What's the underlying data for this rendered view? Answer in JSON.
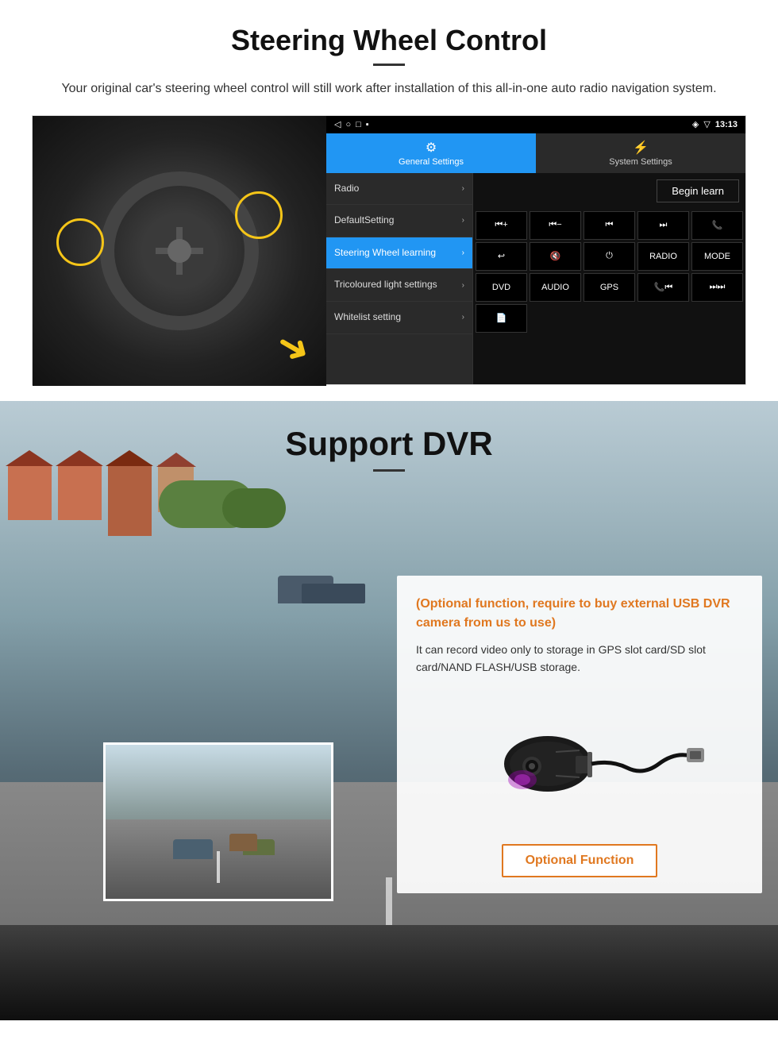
{
  "steering_section": {
    "title": "Steering Wheel Control",
    "description": "Your original car's steering wheel control will still work after installation of this all-in-one auto radio navigation system.",
    "android_ui": {
      "status_bar": {
        "signal": "▼",
        "wifi": "▼",
        "time": "13:13"
      },
      "tabs": [
        {
          "icon": "⚙",
          "label": "General Settings",
          "active": true
        },
        {
          "icon": "⚡",
          "label": "System Settings",
          "active": false
        }
      ],
      "menu_items": [
        {
          "label": "Radio",
          "active": false
        },
        {
          "label": "DefaultSetting",
          "active": false
        },
        {
          "label": "Steering Wheel learning",
          "active": true
        },
        {
          "label": "Tricoloured light settings",
          "active": false
        },
        {
          "label": "Whitelist setting",
          "active": false
        }
      ],
      "begin_learn_button": "Begin learn",
      "control_buttons": [
        "▐+",
        "▐−",
        "⏮",
        "⏭",
        "📞",
        "↩",
        "🔇×",
        "⏻",
        "RADIO",
        "MODE",
        "DVD",
        "AUDIO",
        "GPS",
        "📞⏮",
        "⏭⏭"
      ],
      "extra_button": "📄"
    }
  },
  "dvr_section": {
    "title": "Support DVR",
    "optional_text": "(Optional function, require to buy external USB DVR camera from us to use)",
    "description": "It can record video only to storage in GPS slot card/SD slot card/NAND FLASH/USB storage.",
    "optional_function_button": "Optional Function"
  }
}
